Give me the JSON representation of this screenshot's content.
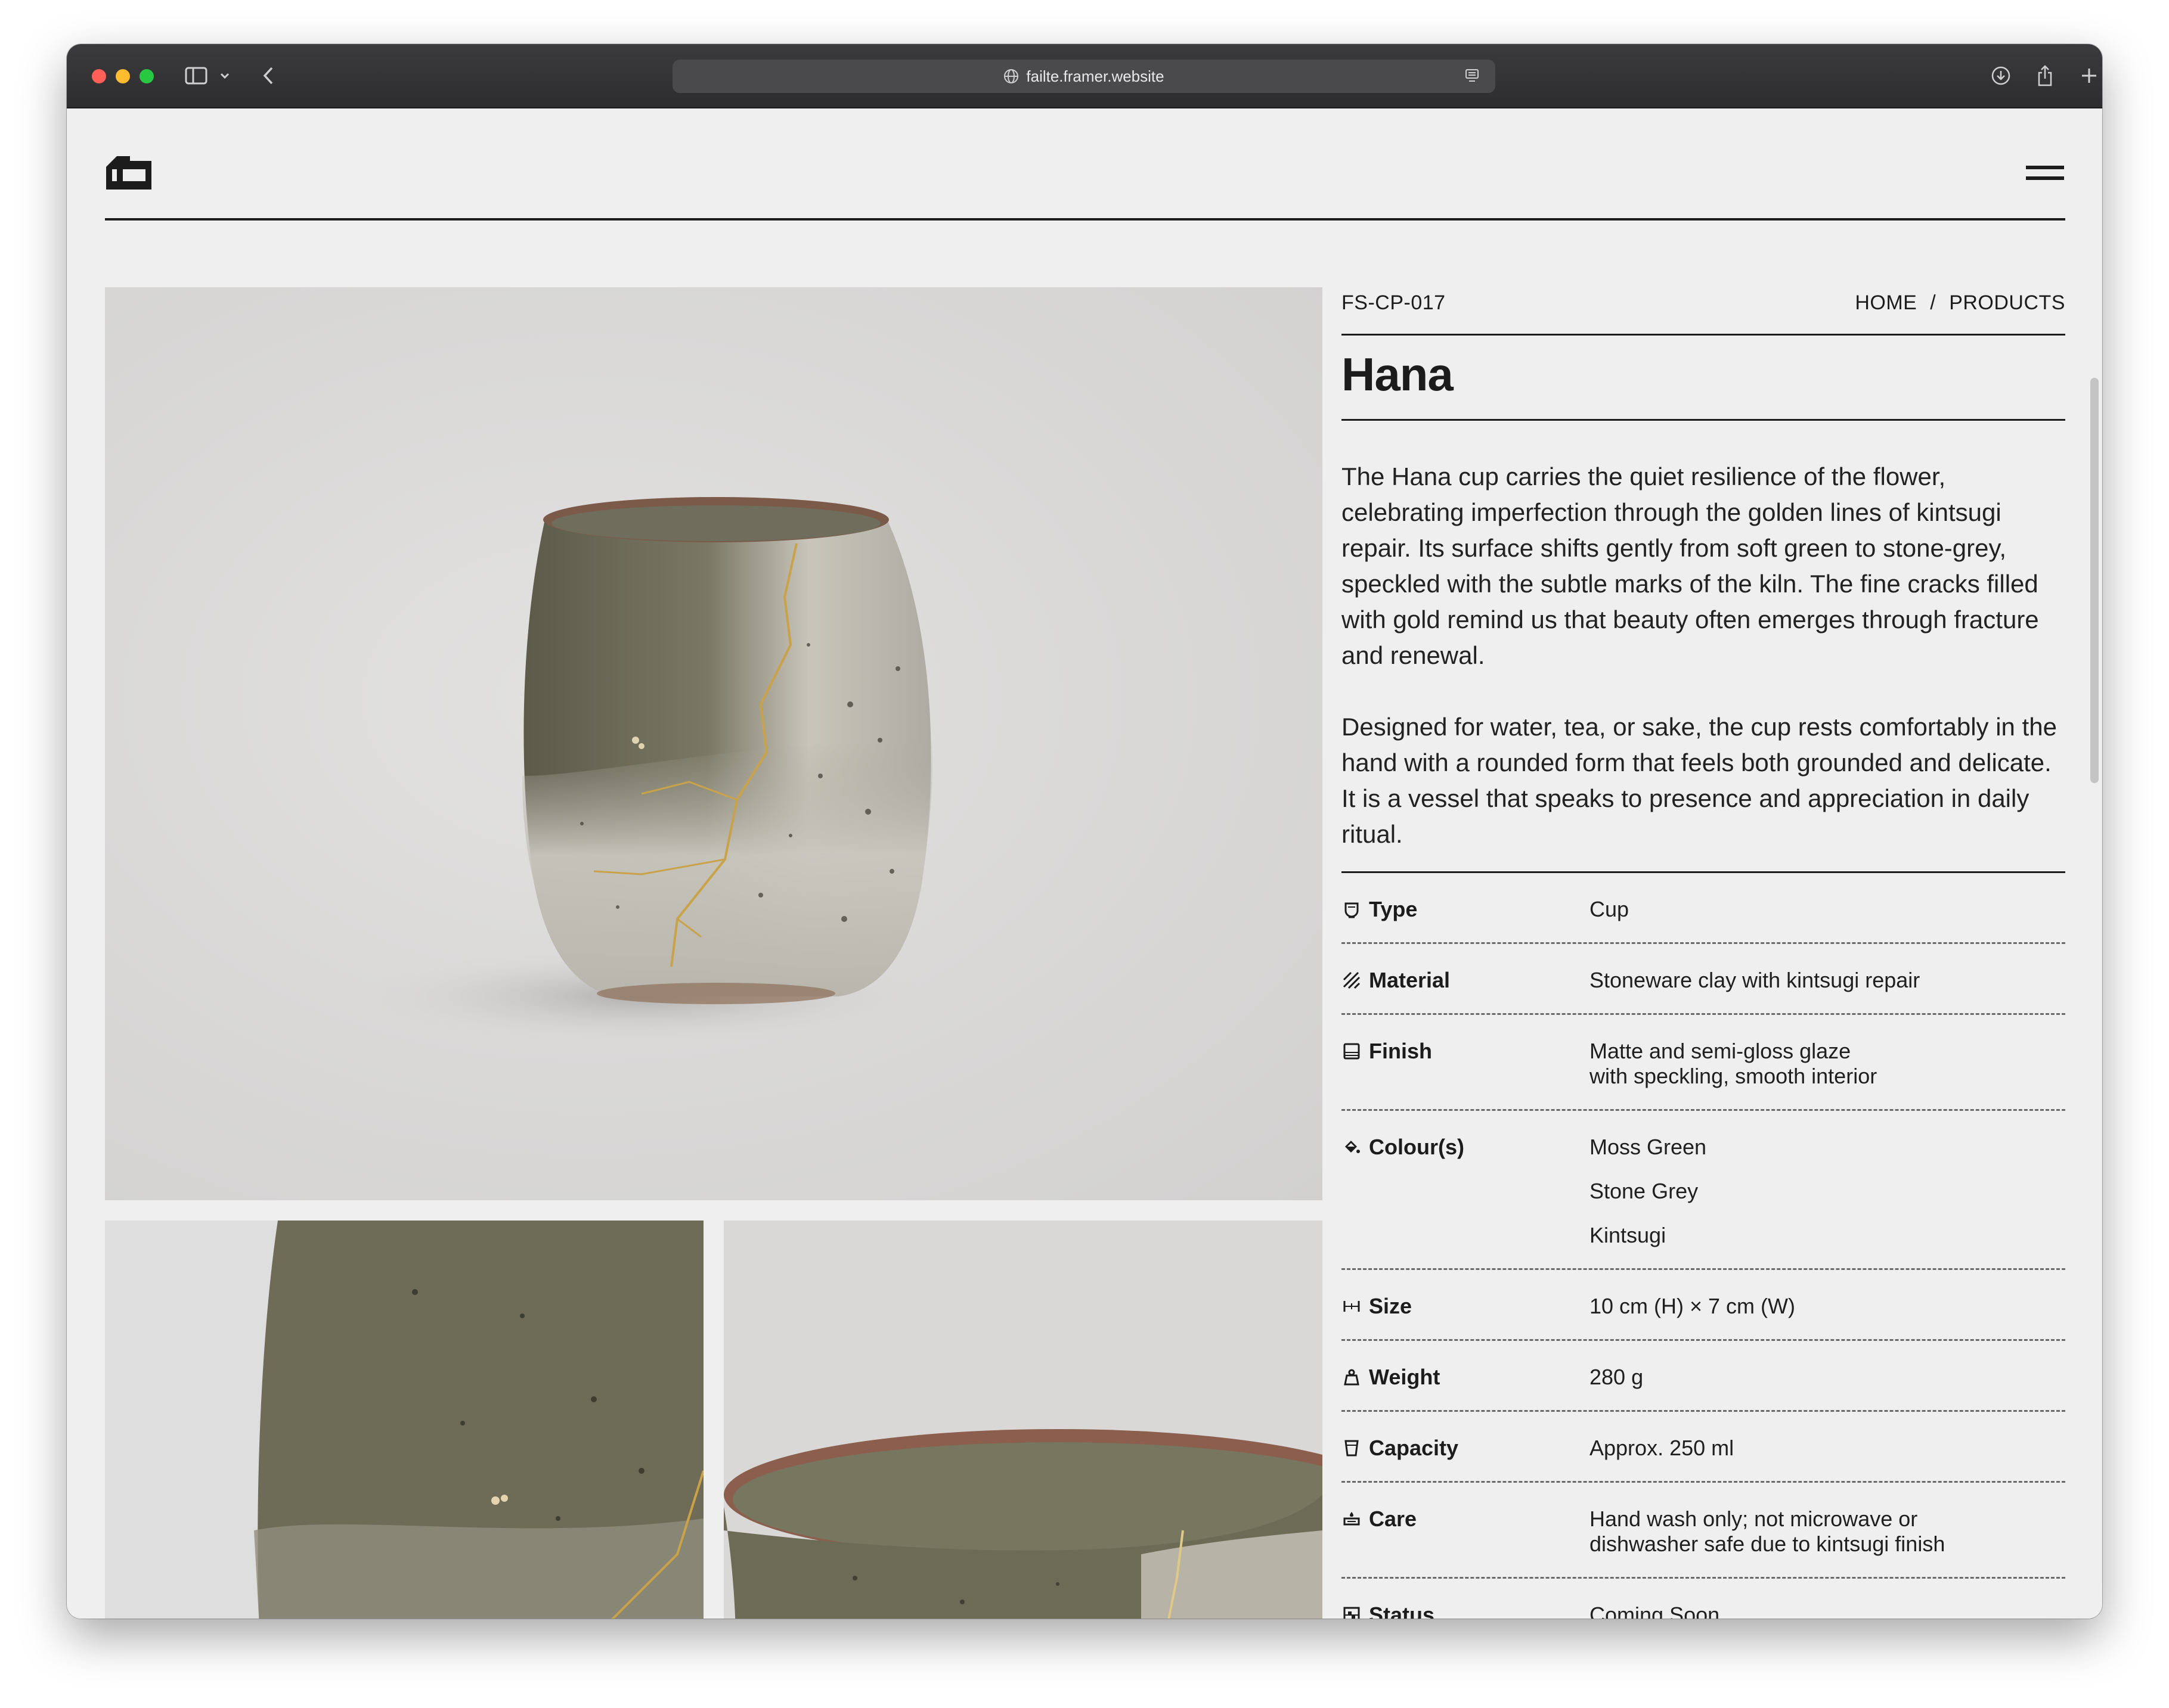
{
  "browser": {
    "url": "failte.framer.website"
  },
  "product": {
    "code": "FS-CP-017",
    "breadcrumb": {
      "home": "HOME",
      "separator": "/",
      "products": "PRODUCTS"
    },
    "name": "Hana",
    "description": [
      "The Hana cup carries the quiet resilience of the flower, celebrating imperfection through the golden lines of kintsugi repair. Its surface shifts gently from soft green to stone-grey, speckled with the subtle marks of the kiln. The fine cracks filled with gold remind us that beauty often emerges through fracture and renewal.",
      "Designed for water, tea, or sake, the cup rests comfortably in the hand with a rounded form that feels both grounded and delicate. It is a vessel that speaks to presence and appreciation in daily ritual."
    ],
    "specs": {
      "type": {
        "label": "Type",
        "icon": "cup-icon",
        "value": "Cup"
      },
      "material": {
        "label": "Material",
        "icon": "hatch-icon",
        "value": "Stoneware clay with kintsugi repair"
      },
      "finish": {
        "label": "Finish",
        "icon": "finish-icon",
        "line1": "Matte and semi-gloss glaze",
        "line2": "with speckling, smooth interior"
      },
      "colours": {
        "label": "Colour(s)",
        "icon": "paint-bucket-icon",
        "values": [
          "Moss Green",
          "Stone Grey",
          "Kintsugi"
        ]
      },
      "size": {
        "label": "Size",
        "icon": "ruler-icon",
        "value": "10 cm (H) × 7 cm (W)"
      },
      "weight": {
        "label": "Weight",
        "icon": "weight-icon",
        "value": "280 g"
      },
      "capacity": {
        "label": "Capacity",
        "icon": "glass-icon",
        "value": "Approx. 250 ml"
      },
      "care": {
        "label": "Care",
        "icon": "hand-wash-icon",
        "line1": "Hand wash only; not microwave or",
        "line2": "dishwasher safe due to kintsugi finish"
      },
      "status": {
        "label": "Status",
        "icon": "status-icon",
        "value": "Coming Soon"
      }
    }
  },
  "colors": {
    "page_bg": "#efefef",
    "text": "#1c1c1c",
    "glaze_green": "#6f6d59",
    "stone_grey": "#d6d4cc",
    "kintsugi_gold": "#c9a24a"
  }
}
